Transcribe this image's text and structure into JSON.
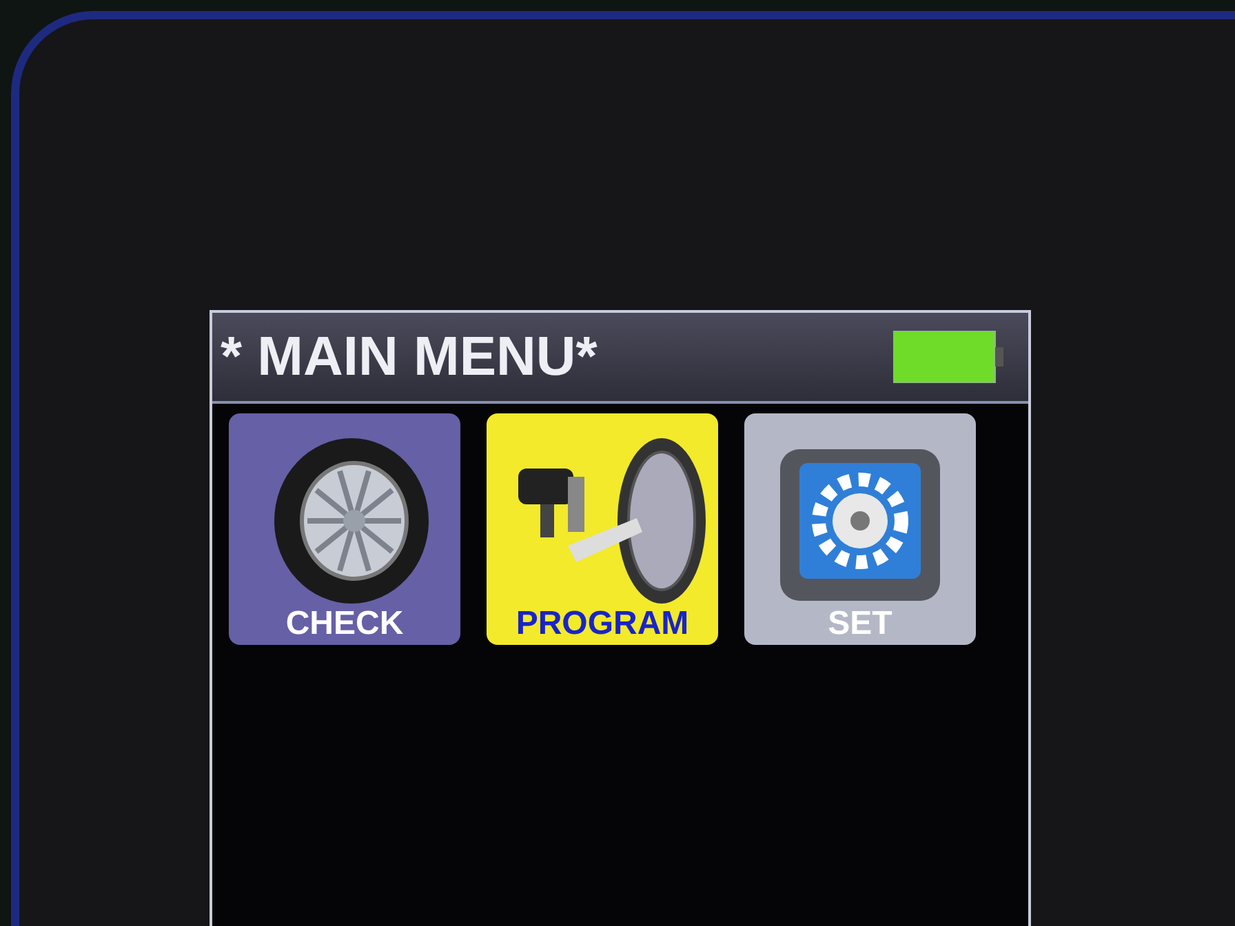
{
  "screen": {
    "title": "* MAIN MENU*",
    "menu_items": [
      {
        "label": "CHECK",
        "kind": "tire",
        "selected": false
      },
      {
        "label": "PROGRAM",
        "kind": "sensor",
        "selected": true
      },
      {
        "label": "SET",
        "kind": "gear",
        "selected": false
      }
    ]
  }
}
